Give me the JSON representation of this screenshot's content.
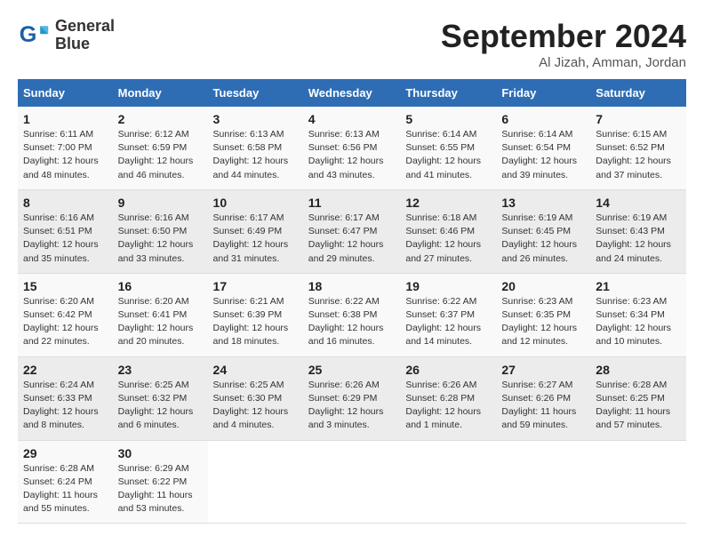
{
  "logo": {
    "line1": "General",
    "line2": "Blue"
  },
  "header": {
    "month": "September 2024",
    "location": "Al Jizah, Amman, Jordan"
  },
  "weekdays": [
    "Sunday",
    "Monday",
    "Tuesday",
    "Wednesday",
    "Thursday",
    "Friday",
    "Saturday"
  ],
  "weeks": [
    [
      {
        "day": "1",
        "info": "Sunrise: 6:11 AM\nSunset: 7:00 PM\nDaylight: 12 hours\nand 48 minutes."
      },
      {
        "day": "2",
        "info": "Sunrise: 6:12 AM\nSunset: 6:59 PM\nDaylight: 12 hours\nand 46 minutes."
      },
      {
        "day": "3",
        "info": "Sunrise: 6:13 AM\nSunset: 6:58 PM\nDaylight: 12 hours\nand 44 minutes."
      },
      {
        "day": "4",
        "info": "Sunrise: 6:13 AM\nSunset: 6:56 PM\nDaylight: 12 hours\nand 43 minutes."
      },
      {
        "day": "5",
        "info": "Sunrise: 6:14 AM\nSunset: 6:55 PM\nDaylight: 12 hours\nand 41 minutes."
      },
      {
        "day": "6",
        "info": "Sunrise: 6:14 AM\nSunset: 6:54 PM\nDaylight: 12 hours\nand 39 minutes."
      },
      {
        "day": "7",
        "info": "Sunrise: 6:15 AM\nSunset: 6:52 PM\nDaylight: 12 hours\nand 37 minutes."
      }
    ],
    [
      {
        "day": "8",
        "info": "Sunrise: 6:16 AM\nSunset: 6:51 PM\nDaylight: 12 hours\nand 35 minutes."
      },
      {
        "day": "9",
        "info": "Sunrise: 6:16 AM\nSunset: 6:50 PM\nDaylight: 12 hours\nand 33 minutes."
      },
      {
        "day": "10",
        "info": "Sunrise: 6:17 AM\nSunset: 6:49 PM\nDaylight: 12 hours\nand 31 minutes."
      },
      {
        "day": "11",
        "info": "Sunrise: 6:17 AM\nSunset: 6:47 PM\nDaylight: 12 hours\nand 29 minutes."
      },
      {
        "day": "12",
        "info": "Sunrise: 6:18 AM\nSunset: 6:46 PM\nDaylight: 12 hours\nand 27 minutes."
      },
      {
        "day": "13",
        "info": "Sunrise: 6:19 AM\nSunset: 6:45 PM\nDaylight: 12 hours\nand 26 minutes."
      },
      {
        "day": "14",
        "info": "Sunrise: 6:19 AM\nSunset: 6:43 PM\nDaylight: 12 hours\nand 24 minutes."
      }
    ],
    [
      {
        "day": "15",
        "info": "Sunrise: 6:20 AM\nSunset: 6:42 PM\nDaylight: 12 hours\nand 22 minutes."
      },
      {
        "day": "16",
        "info": "Sunrise: 6:20 AM\nSunset: 6:41 PM\nDaylight: 12 hours\nand 20 minutes."
      },
      {
        "day": "17",
        "info": "Sunrise: 6:21 AM\nSunset: 6:39 PM\nDaylight: 12 hours\nand 18 minutes."
      },
      {
        "day": "18",
        "info": "Sunrise: 6:22 AM\nSunset: 6:38 PM\nDaylight: 12 hours\nand 16 minutes."
      },
      {
        "day": "19",
        "info": "Sunrise: 6:22 AM\nSunset: 6:37 PM\nDaylight: 12 hours\nand 14 minutes."
      },
      {
        "day": "20",
        "info": "Sunrise: 6:23 AM\nSunset: 6:35 PM\nDaylight: 12 hours\nand 12 minutes."
      },
      {
        "day": "21",
        "info": "Sunrise: 6:23 AM\nSunset: 6:34 PM\nDaylight: 12 hours\nand 10 minutes."
      }
    ],
    [
      {
        "day": "22",
        "info": "Sunrise: 6:24 AM\nSunset: 6:33 PM\nDaylight: 12 hours\nand 8 minutes."
      },
      {
        "day": "23",
        "info": "Sunrise: 6:25 AM\nSunset: 6:32 PM\nDaylight: 12 hours\nand 6 minutes."
      },
      {
        "day": "24",
        "info": "Sunrise: 6:25 AM\nSunset: 6:30 PM\nDaylight: 12 hours\nand 4 minutes."
      },
      {
        "day": "25",
        "info": "Sunrise: 6:26 AM\nSunset: 6:29 PM\nDaylight: 12 hours\nand 3 minutes."
      },
      {
        "day": "26",
        "info": "Sunrise: 6:26 AM\nSunset: 6:28 PM\nDaylight: 12 hours\nand 1 minute."
      },
      {
        "day": "27",
        "info": "Sunrise: 6:27 AM\nSunset: 6:26 PM\nDaylight: 11 hours\nand 59 minutes."
      },
      {
        "day": "28",
        "info": "Sunrise: 6:28 AM\nSunset: 6:25 PM\nDaylight: 11 hours\nand 57 minutes."
      }
    ],
    [
      {
        "day": "29",
        "info": "Sunrise: 6:28 AM\nSunset: 6:24 PM\nDaylight: 11 hours\nand 55 minutes."
      },
      {
        "day": "30",
        "info": "Sunrise: 6:29 AM\nSunset: 6:22 PM\nDaylight: 11 hours\nand 53 minutes."
      },
      {
        "day": "",
        "info": ""
      },
      {
        "day": "",
        "info": ""
      },
      {
        "day": "",
        "info": ""
      },
      {
        "day": "",
        "info": ""
      },
      {
        "day": "",
        "info": ""
      }
    ]
  ]
}
